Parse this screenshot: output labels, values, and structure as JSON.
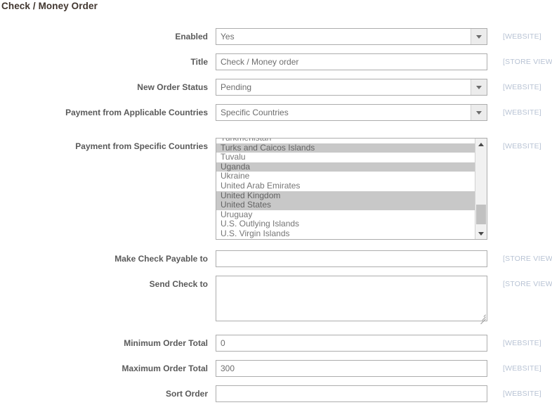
{
  "page": {
    "title": "Check / Money Order"
  },
  "scopes": {
    "website": "[WEBSITE]",
    "store_view": "[STORE VIEW]"
  },
  "fields": {
    "enabled": {
      "label": "Enabled",
      "value": "Yes",
      "scope": "[WEBSITE]"
    },
    "title": {
      "label": "Title",
      "value": "Check / Money order",
      "placeholder": "",
      "scope": "[STORE VIEW]"
    },
    "new_order_status": {
      "label": "New Order Status",
      "value": "Pending",
      "scope": "[WEBSITE]"
    },
    "payment_applicable_countries": {
      "label": "Payment from Applicable Countries",
      "value": "Specific Countries",
      "scope": "[WEBSITE]"
    },
    "payment_specific_countries": {
      "label": "Payment from Specific Countries",
      "scope": "[WEBSITE]",
      "options": [
        {
          "label": "Turkmenistan",
          "selected": false
        },
        {
          "label": "Turks and Caicos Islands",
          "selected": true
        },
        {
          "label": "Tuvalu",
          "selected": false
        },
        {
          "label": "Uganda",
          "selected": true
        },
        {
          "label": "Ukraine",
          "selected": false
        },
        {
          "label": "United Arab Emirates",
          "selected": false
        },
        {
          "label": "United Kingdom",
          "selected": true
        },
        {
          "label": "United States",
          "selected": true
        },
        {
          "label": "Uruguay",
          "selected": false
        },
        {
          "label": "U.S. Outlying Islands",
          "selected": false
        },
        {
          "label": "U.S. Virgin Islands",
          "selected": false
        }
      ]
    },
    "make_check_payable_to": {
      "label": "Make Check Payable to",
      "value": "",
      "placeholder": "",
      "scope": "[STORE VIEW]"
    },
    "send_check_to": {
      "label": "Send Check to",
      "value": "",
      "placeholder": "",
      "scope": "[STORE VIEW]"
    },
    "minimum_order_total": {
      "label": "Minimum Order Total",
      "value": "0",
      "placeholder": "",
      "scope": "[WEBSITE]"
    },
    "maximum_order_total": {
      "label": "Maximum Order Total",
      "value": "300",
      "placeholder": "",
      "scope": "[WEBSITE]"
    },
    "sort_order": {
      "label": "Sort Order",
      "value": "",
      "placeholder": "",
      "scope": "[WEBSITE]"
    }
  },
  "colors": {
    "label_text": "#5a5a5a",
    "value_text": "#6e6e6e",
    "scope_text": "#b8c3d4",
    "border": "#adadad",
    "selected_row_bg": "#c8c8c8",
    "dropdown_button_bg": "#ececec"
  }
}
